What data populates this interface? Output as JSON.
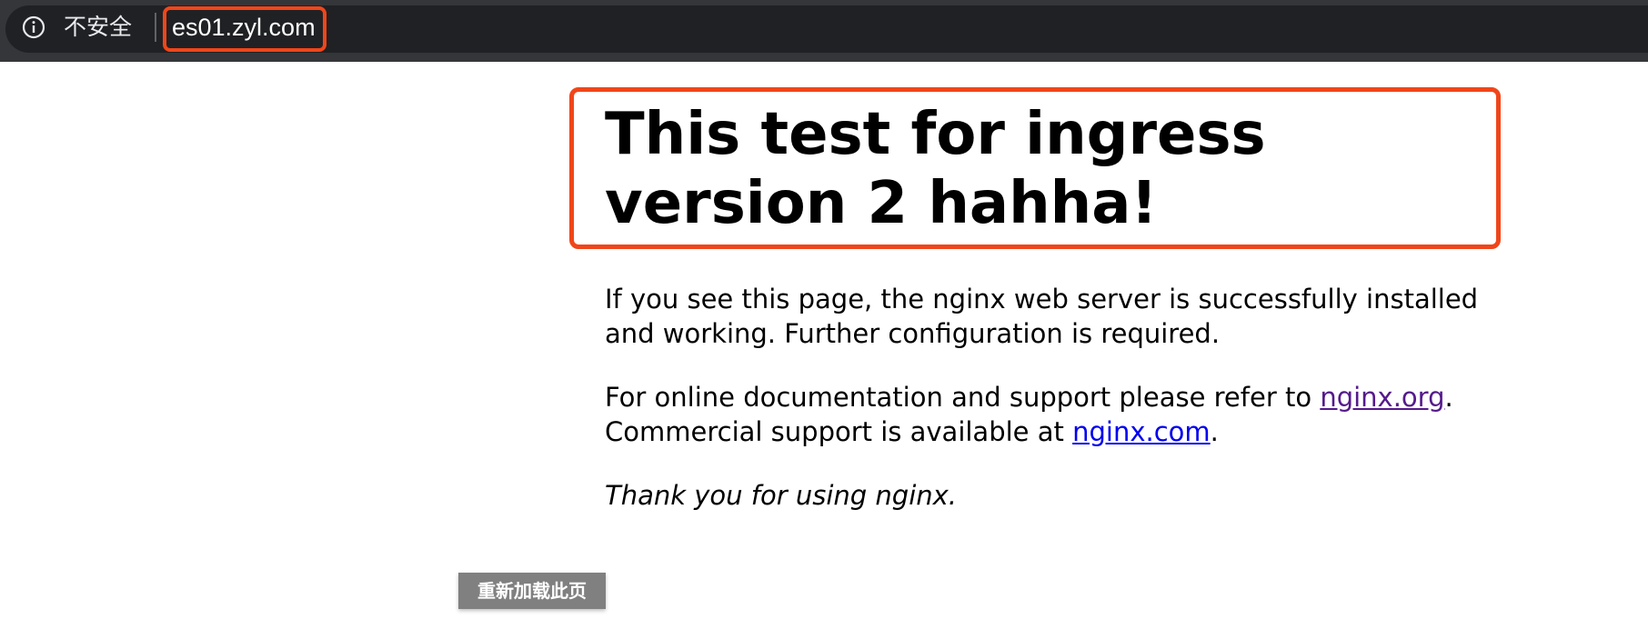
{
  "omnibox": {
    "security_label": "不安全",
    "url": "es01.zyl.com",
    "icon": "info-icon"
  },
  "page": {
    "heading": "This test for ingress version 2 hahha!",
    "para1": "If you see this page, the nginx web server is successfully installed and working. Further configuration is required.",
    "para2_before": "For online documentation and support please refer to ",
    "link_org": "nginx.org",
    "para2_mid": ".",
    "para2_line2_before": "Commercial support is available at ",
    "link_com": "nginx.com",
    "para2_after": ".",
    "thanks": "Thank you for using nginx."
  },
  "reload_button": {
    "label": "重新加载此页"
  },
  "colors": {
    "highlight": "#f0461a",
    "visited_link": "#551a8b",
    "link": "#0000ee"
  }
}
